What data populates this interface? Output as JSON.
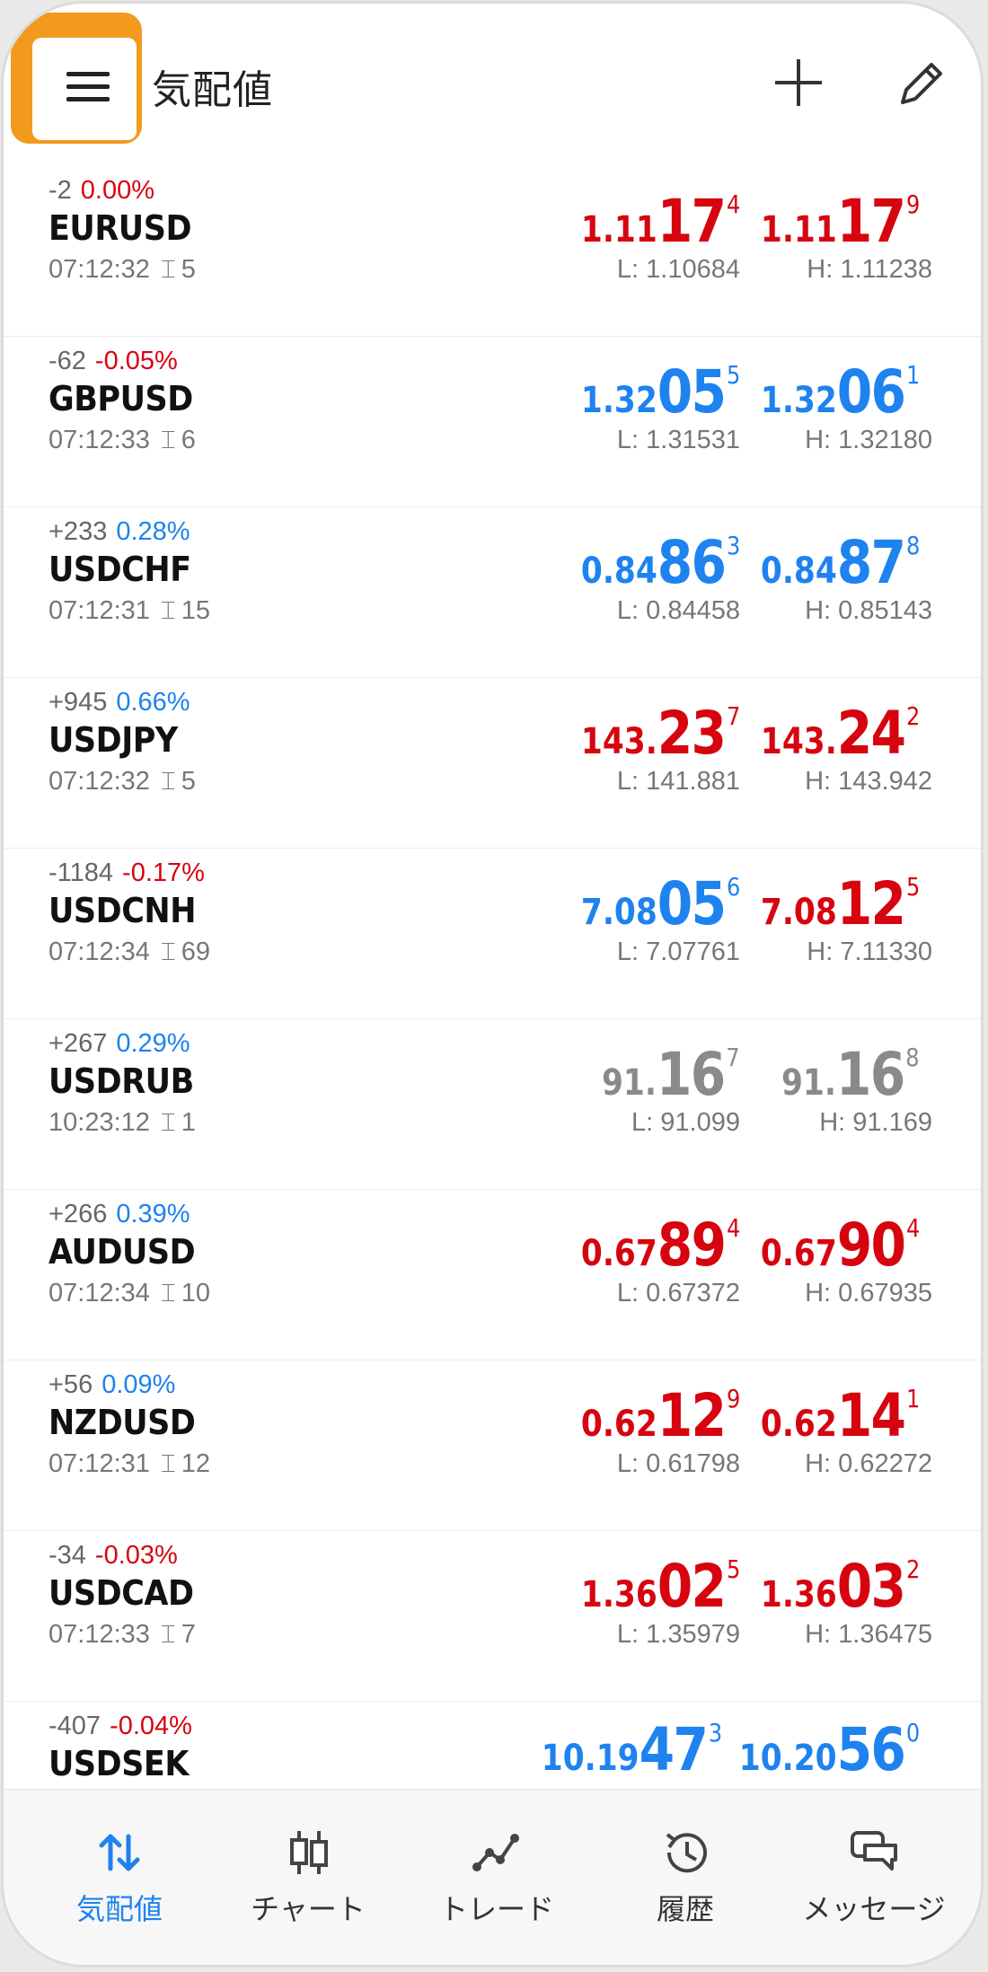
{
  "header": {
    "title": "気配値",
    "menu_icon": "hamburger-menu-icon",
    "add_icon": "plus-icon",
    "edit_icon": "pencil-icon"
  },
  "colors": {
    "up": "#1e82ef",
    "down": "#d6040f",
    "neutral": "#8a8a8a",
    "highlight": "#f29a1e"
  },
  "quotes": [
    {
      "change": "-2",
      "percent": "0.00%",
      "percent_color": "red",
      "symbol": "EURUSD",
      "time": "07:12:32",
      "spread": "5",
      "bid": {
        "small": "1.11",
        "big": "17",
        "sup": "4",
        "color": "red"
      },
      "ask": {
        "small": "1.11",
        "big": "17",
        "sup": "9",
        "color": "red"
      },
      "low": "L: 1.10684",
      "high": "H: 1.11238"
    },
    {
      "change": "-62",
      "percent": "-0.05%",
      "percent_color": "red",
      "symbol": "GBPUSD",
      "time": "07:12:33",
      "spread": "6",
      "bid": {
        "small": "1.32",
        "big": "05",
        "sup": "5",
        "color": "blue"
      },
      "ask": {
        "small": "1.32",
        "big": "06",
        "sup": "1",
        "color": "blue"
      },
      "low": "L: 1.31531",
      "high": "H: 1.32180"
    },
    {
      "change": "+233",
      "percent": "0.28%",
      "percent_color": "blue",
      "symbol": "USDCHF",
      "time": "07:12:31",
      "spread": "15",
      "bid": {
        "small": "0.84",
        "big": "86",
        "sup": "3",
        "color": "blue"
      },
      "ask": {
        "small": "0.84",
        "big": "87",
        "sup": "8",
        "color": "blue"
      },
      "low": "L: 0.84458",
      "high": "H: 0.85143"
    },
    {
      "change": "+945",
      "percent": "0.66%",
      "percent_color": "blue",
      "symbol": "USDJPY",
      "time": "07:12:32",
      "spread": "5",
      "bid": {
        "small": "143.",
        "big": "23",
        "sup": "7",
        "color": "red"
      },
      "ask": {
        "small": "143.",
        "big": "24",
        "sup": "2",
        "color": "red"
      },
      "low": "L: 141.881",
      "high": "H: 143.942"
    },
    {
      "change": "-1184",
      "percent": "-0.17%",
      "percent_color": "red",
      "symbol": "USDCNH",
      "time": "07:12:34",
      "spread": "69",
      "bid": {
        "small": "7.08",
        "big": "05",
        "sup": "6",
        "color": "blue"
      },
      "ask": {
        "small": "7.08",
        "big": "12",
        "sup": "5",
        "color": "red"
      },
      "low": "L: 7.07761",
      "high": "H: 7.11330"
    },
    {
      "change": "+267",
      "percent": "0.29%",
      "percent_color": "blue",
      "symbol": "USDRUB",
      "time": "10:23:12",
      "spread": "1",
      "bid": {
        "small": "91.",
        "big": "16",
        "sup": "7",
        "color": "gray"
      },
      "ask": {
        "small": "91.",
        "big": "16",
        "sup": "8",
        "color": "gray"
      },
      "low": "L: 91.099",
      "high": "H: 91.169"
    },
    {
      "change": "+266",
      "percent": "0.39%",
      "percent_color": "blue",
      "symbol": "AUDUSD",
      "time": "07:12:34",
      "spread": "10",
      "bid": {
        "small": "0.67",
        "big": "89",
        "sup": "4",
        "color": "red"
      },
      "ask": {
        "small": "0.67",
        "big": "90",
        "sup": "4",
        "color": "red"
      },
      "low": "L: 0.67372",
      "high": "H: 0.67935"
    },
    {
      "change": "+56",
      "percent": "0.09%",
      "percent_color": "blue",
      "symbol": "NZDUSD",
      "time": "07:12:31",
      "spread": "12",
      "bid": {
        "small": "0.62",
        "big": "12",
        "sup": "9",
        "color": "red"
      },
      "ask": {
        "small": "0.62",
        "big": "14",
        "sup": "1",
        "color": "red"
      },
      "low": "L: 0.61798",
      "high": "H: 0.62272"
    },
    {
      "change": "-34",
      "percent": "-0.03%",
      "percent_color": "red",
      "symbol": "USDCAD",
      "time": "07:12:33",
      "spread": "7",
      "bid": {
        "small": "1.36",
        "big": "02",
        "sup": "5",
        "color": "red"
      },
      "ask": {
        "small": "1.36",
        "big": "03",
        "sup": "2",
        "color": "red"
      },
      "low": "L: 1.35979",
      "high": "H: 1.36475"
    },
    {
      "change": "-407",
      "percent": "-0.04%",
      "percent_color": "red",
      "symbol": "USDSEK",
      "time": "",
      "spread": "",
      "bid": {
        "small": "10.19",
        "big": "47",
        "sup": "3",
        "color": "blue"
      },
      "ask": {
        "small": "10.20",
        "big": "56",
        "sup": "0",
        "color": "blue"
      },
      "low": "",
      "high": ""
    }
  ],
  "nav": [
    {
      "label": "気配値",
      "icon": "quotes-arrows-icon",
      "active": true
    },
    {
      "label": "チャート",
      "icon": "chart-candles-icon",
      "active": false
    },
    {
      "label": "トレード",
      "icon": "trade-line-icon",
      "active": false
    },
    {
      "label": "履歴",
      "icon": "history-clock-icon",
      "active": false
    },
    {
      "label": "メッセージ",
      "icon": "messages-icon",
      "active": false
    }
  ]
}
